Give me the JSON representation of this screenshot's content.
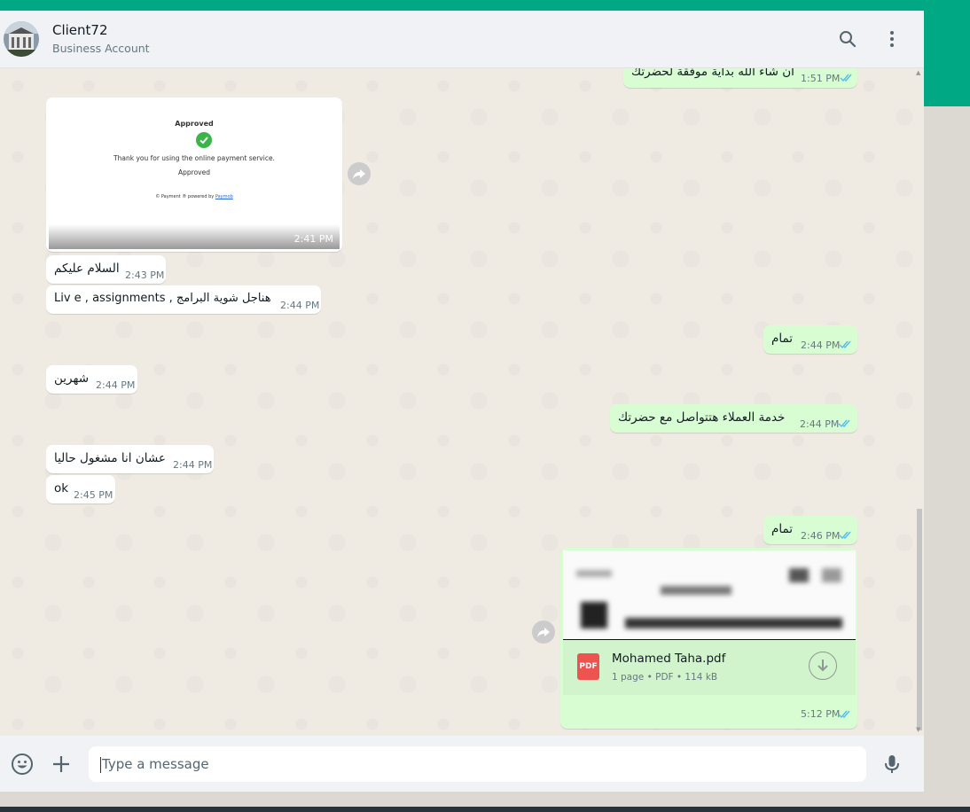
{
  "header": {
    "contact_name": "Client72",
    "contact_subtitle": "Business Account",
    "icons": [
      "search-icon",
      "menu-icon"
    ]
  },
  "messages": [
    {
      "direction": "outgoing",
      "text": "ان شاء الله بداية موفقة لحضرتك",
      "time": "1:51 PM",
      "status": "read"
    },
    {
      "direction": "incoming",
      "type": "image",
      "image_title": "Approved",
      "image_body": "Thank you for using the online payment service.",
      "image_status": "Approved",
      "image_footer_prefix": "© Payment ® powered by",
      "image_footer_link": "Paymob",
      "time": "2:41 PM"
    },
    {
      "direction": "incoming",
      "text": "السلام عليكم",
      "time": "2:43 PM"
    },
    {
      "direction": "incoming",
      "text": "هناجل شوية البرامج ,  Liv e ,  assignments",
      "time": "2:44 PM"
    },
    {
      "direction": "outgoing",
      "text": "تمام",
      "time": "2:44 PM",
      "status": "read"
    },
    {
      "direction": "incoming",
      "text": "شهرين",
      "time": "2:44 PM"
    },
    {
      "direction": "outgoing",
      "text": "خدمة العملاء هتتواصل مع حضرتك",
      "time": "2:44 PM",
      "status": "read"
    },
    {
      "direction": "incoming",
      "text": "عشان انا مشغول حاليا",
      "time": "2:44 PM"
    },
    {
      "direction": "incoming",
      "text": "ok",
      "time": "2:45 PM"
    },
    {
      "direction": "outgoing",
      "text": "تمام",
      "time": "2:46 PM",
      "status": "read"
    },
    {
      "direction": "outgoing",
      "type": "document",
      "file_badge": "PDF",
      "file_name": "Mohamed Taha.pdf",
      "file_meta": "1 page • PDF • 114 kB",
      "time": "5:12 PM",
      "status": "read"
    }
  ],
  "composer": {
    "placeholder": "Type a message",
    "icons": [
      "emoji-icon",
      "attach-plus-icon",
      "microphone-icon"
    ]
  },
  "colors": {
    "accent": "#00a884",
    "incoming_bubble": "#ffffff",
    "outgoing_bubble": "#d9fdd3",
    "read_tick": "#53bdeb",
    "chat_background": "#efeae2"
  }
}
